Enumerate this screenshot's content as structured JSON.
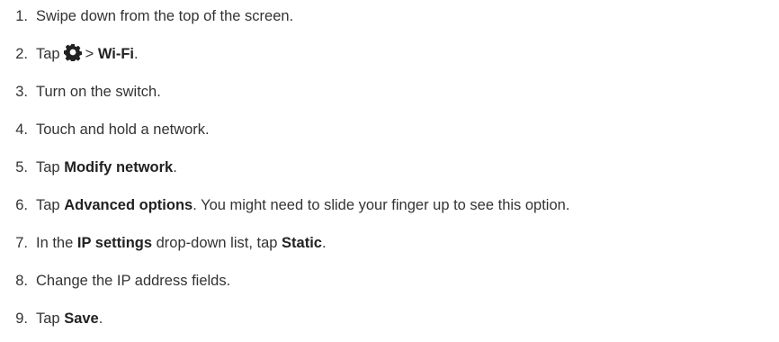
{
  "steps": [
    {
      "number": "1.",
      "parts": [
        "Swipe down from the top of the screen."
      ]
    },
    {
      "number": "2.",
      "parts": [
        "Tap",
        "gear-icon",
        ">",
        "Wi-Fi",
        "."
      ]
    },
    {
      "number": "3.",
      "parts": [
        "Turn on the switch."
      ]
    },
    {
      "number": "4.",
      "parts": [
        "Touch and hold a network."
      ]
    },
    {
      "number": "5.",
      "parts": [
        "Tap",
        "Modify network",
        "."
      ]
    },
    {
      "number": "6.",
      "parts": [
        "Tap",
        "Advanced options",
        ". You might need to slide your finger up to see this option."
      ]
    },
    {
      "number": "7.",
      "parts": [
        "In the",
        "IP settings",
        "drop-down list, tap",
        "Static",
        "."
      ]
    },
    {
      "number": "8.",
      "parts": [
        "Change the IP address fields."
      ]
    },
    {
      "number": "9.",
      "parts": [
        "Tap",
        "Save",
        "."
      ]
    }
  ]
}
